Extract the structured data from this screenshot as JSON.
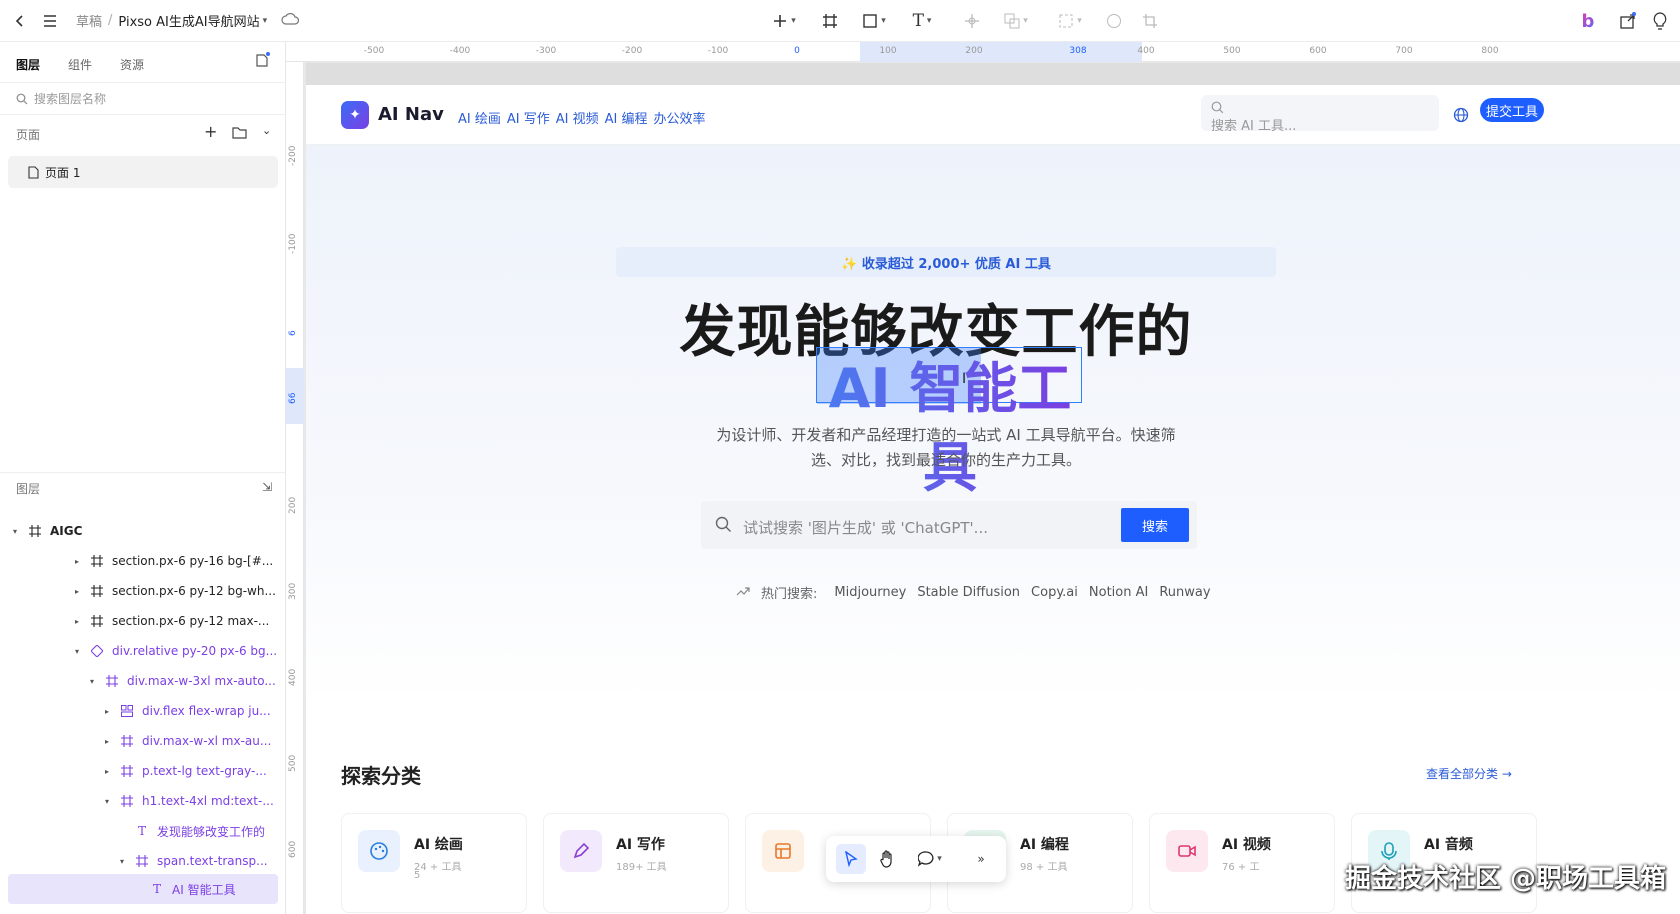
{
  "topbar": {
    "breadcrumb_folder": "草稿",
    "breadcrumb_sep": "/",
    "file_name": "Pixso AI生成AI导航网站"
  },
  "left_panel": {
    "tabs": [
      "图层",
      "组件",
      "资源"
    ],
    "search_placeholder": "搜索图层名称",
    "pages_header": "页面",
    "pages": [
      "页面 1"
    ],
    "layers_header": "图层",
    "layers": [
      {
        "label": "AIGC",
        "depth": 0,
        "expanded": true,
        "kind": "frame"
      },
      {
        "label": "section.px-6 py-16 bg-[#...",
        "depth": 1,
        "expanded": false,
        "kind": "frame"
      },
      {
        "label": "section.px-6 py-12 bg-wh...",
        "depth": 1,
        "expanded": false,
        "kind": "frame"
      },
      {
        "label": "section.px-6 py-12 max-...",
        "depth": 1,
        "expanded": false,
        "kind": "frame"
      },
      {
        "label": "div.relative py-20 px-6 bg...",
        "depth": 1,
        "expanded": true,
        "kind": "component"
      },
      {
        "label": "div.max-w-3xl mx-auto...",
        "depth": 2,
        "expanded": true,
        "kind": "frame"
      },
      {
        "label": "div.flex flex-wrap ju...",
        "depth": 3,
        "expanded": false,
        "kind": "autolayout"
      },
      {
        "label": "div.max-w-xl mx-au...",
        "depth": 3,
        "expanded": false,
        "kind": "frame"
      },
      {
        "label": "p.text-lg text-gray-...",
        "depth": 3,
        "expanded": false,
        "kind": "frame"
      },
      {
        "label": "h1.text-4xl md:text-...",
        "depth": 3,
        "expanded": true,
        "kind": "frame"
      },
      {
        "label": "发现能够改变工作的",
        "depth": 4,
        "expanded": null,
        "kind": "text"
      },
      {
        "label": "span.text-transp...",
        "depth": 4,
        "expanded": true,
        "kind": "frame"
      },
      {
        "label": "AI 智能工具",
        "depth": 5,
        "expanded": null,
        "kind": "text",
        "selected": true
      }
    ]
  },
  "rulers": {
    "horizontal": [
      "-500",
      "-400",
      "-300",
      "-200",
      "-100",
      "0",
      "100",
      "200",
      "308",
      "400",
      "500",
      "600",
      "700",
      "800"
    ],
    "vertical": [
      "-200",
      "-100",
      "6",
      "66",
      "200",
      "300",
      "400",
      "500",
      "600"
    ]
  },
  "site": {
    "logo_text": "AI Nav",
    "nav_links": [
      "AI 绘画",
      "AI 写作",
      "AI 视频",
      "AI 编程",
      "办公效率"
    ],
    "nav_search_placeholder": "搜索 AI 工具...",
    "submit_label": "提交工具",
    "badge": "✨ 收录超过 2,000+ 优质 AI 工具",
    "headline_line1": "发现能够改变工作的",
    "headline_line2": "AI 智能工具",
    "subtitle": "为设计师、开发者和产品经理打造的一站式 AI 工具导航平台。快速筛选、对比，找到最适合你的生产力工具。",
    "hero_search_placeholder": "试试搜索 '图片生成' 或 'ChatGPT'...",
    "hero_search_button": "搜索",
    "hot_label": "热门搜索:",
    "hot_items": [
      "Midjourney",
      "Stable Diffusion",
      "Copy.ai",
      "Notion AI",
      "Runway"
    ],
    "section_title": "探索分类",
    "section_link": "查看全部分类 →",
    "categories": [
      {
        "name": "AI 绘画",
        "count": "24 + 工具",
        "extra": "5",
        "color": "#2a7de1",
        "bg": "#e8f1fd",
        "icon": "palette-icon"
      },
      {
        "name": "AI 写作",
        "count": "189+ 工具",
        "extra": "",
        "color": "#8a3fd1",
        "bg": "#f2eafc",
        "icon": "pen-icon"
      },
      {
        "name": "",
        "count": "",
        "extra": "",
        "color": "#e8782a",
        "bg": "#fdf0e4",
        "icon": "layout-icon"
      },
      {
        "name": "AI 编程",
        "count": "98 + 工具",
        "extra": "",
        "color": "#2aa56b",
        "bg": "#e6f6ee",
        "icon": "code-icon"
      },
      {
        "name": "AI 视频",
        "count": "76 + 工",
        "extra": "",
        "color": "#e0366f",
        "bg": "#fde8ef",
        "icon": "video-icon"
      },
      {
        "name": "AI 音频",
        "count": "",
        "extra": "",
        "color": "#1aa0b8",
        "bg": "#e4f5f8",
        "icon": "audio-icon"
      }
    ]
  },
  "watermark": "掘金技术社区 @职场工具箱"
}
